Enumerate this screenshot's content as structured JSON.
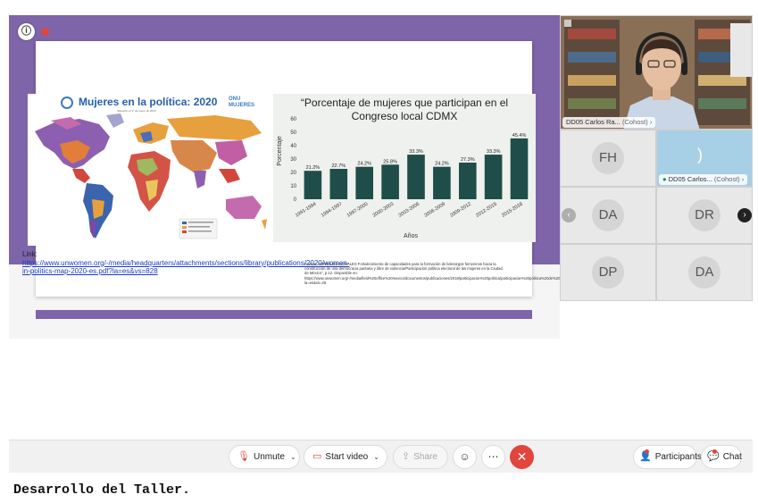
{
  "slide": {
    "map": {
      "title": "Mujeres en la política: 2020",
      "subtitle": "Situación al 1° de enero de 2020",
      "logo_text": "ONU MUJERES"
    },
    "chart_data": {
      "type": "bar",
      "title": "“Porcentaje de mujeres que participan en el Congreso local CDMX",
      "xlabel": "Años",
      "ylabel": "Porcentaje",
      "ylim": [
        0,
        60
      ],
      "yticks": [
        "0",
        "10",
        "20",
        "30",
        "40",
        "50",
        "60"
      ],
      "categories": [
        "1991-1994",
        "1994-1997",
        "1997-2000",
        "2000-2003",
        "2003-2006",
        "2006-2009",
        "2009-2012",
        "2012-2015",
        "2015-2018"
      ],
      "values": [
        21.2,
        22.7,
        24.2,
        25.8,
        33.3,
        24.2,
        27.3,
        33.3,
        45.4
      ],
      "value_labels": [
        "21.2%",
        "22.7%",
        "24.2%",
        "25.8%",
        "33.3%",
        "24.2%",
        "27.3%",
        "33.3%",
        "45.4%"
      ],
      "bar_color": "#1f4e4a"
    },
    "link_label": "Link:",
    "link_url": "https://www.unwomen.org/-/media/headquarters/attachments/sections/library/publications/2020/women-in-politics-map-2020-es.pdf?la=es&vs=828",
    "source": "Fuente: FOROS REGIONALES Fortalecimiento de capacidades para la formación de liderazgos femeninos hacia la construcción de una democracia paritaria y libre de violencia/Participación política electoral de las mujeres en la Ciudad de México\", p.12. Disponible en: https://www.unwomen.org/-/media/field%20office%20mexico/documentos/publicaciones/2018/participacion%20politica/participacion%20politica%20de%20las%20mujeres%20en%20cdmx.pdf?la=es&vs=25"
  },
  "participants": {
    "speaker": {
      "name": "DD05 Carlos Ra...",
      "role": "(Cohost)"
    },
    "active_tile": {
      "name": "DD05 Carlos...",
      "role": "(Cohost)"
    },
    "tiles": [
      {
        "initials": "FH"
      },
      {
        "initials": "DA"
      },
      {
        "initials": "DR"
      },
      {
        "initials": "DP"
      },
      {
        "initials": "DA"
      }
    ]
  },
  "toolbar": {
    "unmute": "Unmute",
    "start_video": "Start video",
    "share": "Share",
    "participants": "Participants",
    "chat": "Chat"
  },
  "caption": "Desarrollo del Taller."
}
